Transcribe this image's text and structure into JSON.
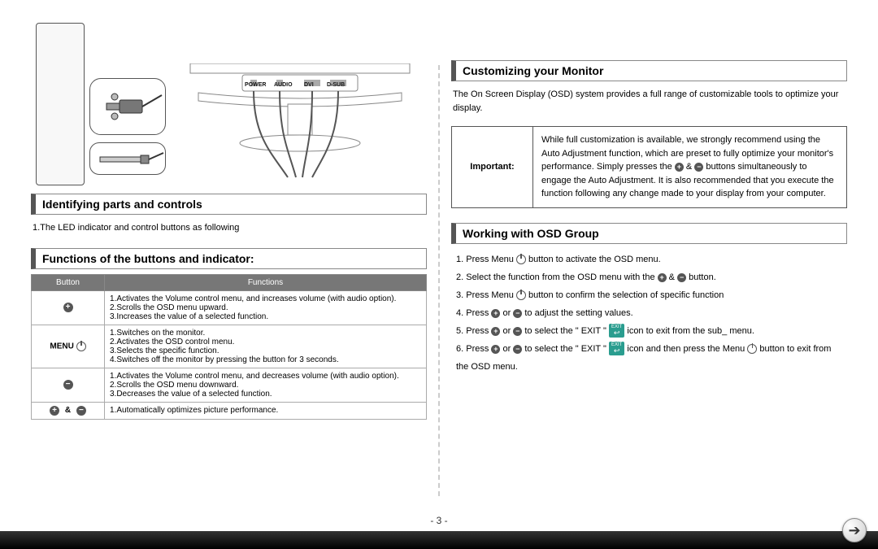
{
  "page_number": "- 3 -",
  "diagram": {
    "port_labels": {
      "power": "POWER",
      "audio": "AUDIO",
      "dvi": "DVI",
      "dsub": "D-SUB"
    }
  },
  "left": {
    "h_identify": "Identifying parts and controls",
    "identify_text": "1.The LED indicator and control buttons as following",
    "h_functions": "Functions of the buttons and indicator:",
    "th_button": "Button",
    "th_functions": "Functions",
    "row_plus": "1.Activates the Volume control menu, and increases volume (with audio option).\n2.Scrolls the OSD menu upward.\n3.Increases the value of a selected function.",
    "menu_label": "MENU",
    "row_menu": "1.Switches on the monitor.\n2.Activates the OSD control menu.\n3.Selects the specific function.\n4.Switches off the monitor by pressing the button for 3 seconds.",
    "row_minus": "1.Activates the Volume control menu, and decreases volume (with audio option).\n2.Scrolls the OSD menu downward.\n3.Decreases the value of a selected function.",
    "amp": "&",
    "row_both": "1.Automatically optimizes picture performance."
  },
  "right": {
    "h_customizing": "Customizing your Monitor",
    "customizing_text": "The On Screen Display (OSD) system provides a full range of customizable tools to optimize your display.",
    "important_label": "Important:",
    "important_pre": "While full customization is available, we strongly recommend using the Auto Adjustment function, which are preset to fully optimize your monitor's performance. Simply presses the ",
    "important_amp": " & ",
    "important_post": " buttons simultaneously to engage the Auto Adjustment. It is also recommended that you execute the function following any change made to your display from your computer.",
    "h_osd": "Working with OSD Group",
    "osd1_a": "1. Press Menu ",
    "osd1_b": " button to activate the OSD menu.",
    "osd2_a": "2. Select the function from the OSD menu with the ",
    "osd2_amp": " & ",
    "osd2_b": " button.",
    "osd3_a": "3. Press Menu ",
    "osd3_b": " button to confirm the selection of specific function",
    "osd4_a": "4. Press ",
    "osd4_or": " or ",
    "osd4_b": " to adjust the setting values.",
    "osd5_a": "5. Press ",
    "osd5_or": " or ",
    "osd5_mid": " to select the \" EXIT \" ",
    "osd5_b": " icon to exit from the sub_ menu.",
    "osd6_a": "6. Press ",
    "osd6_or": " or ",
    "osd6_mid": " to select the \" EXIT \" ",
    "osd6_mid2": " icon and then press the Menu ",
    "osd6_b": " button to exit from the OSD menu."
  }
}
